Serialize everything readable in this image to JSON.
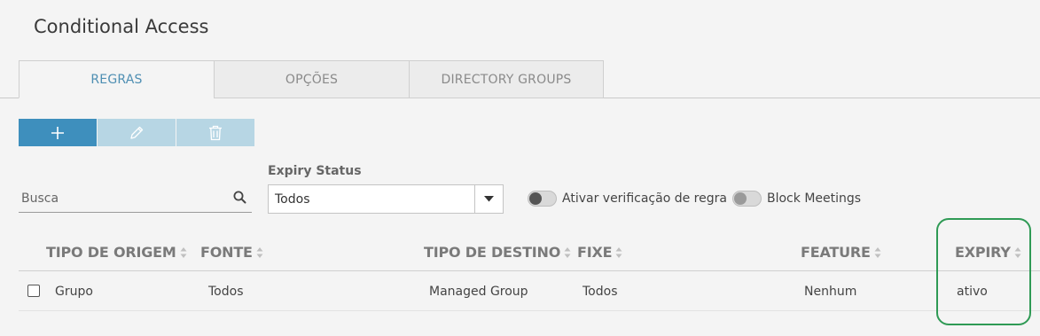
{
  "page": {
    "title": "Conditional Access"
  },
  "tabs": [
    {
      "label": "REGRAS",
      "active": true
    },
    {
      "label": "OPÇÕES",
      "active": false
    },
    {
      "label": "DIRECTORY GROUPS",
      "active": false
    }
  ],
  "toolbar": {
    "add_icon": "plus-icon",
    "edit_icon": "pencil-icon",
    "delete_icon": "trash-icon",
    "add_state": "enabled",
    "edit_state": "disabled",
    "delete_state": "disabled"
  },
  "filters": {
    "search_placeholder": "Busca",
    "search_value": "",
    "expiry_status_label": "Expiry Status",
    "expiry_status_value": "Todos",
    "toggle_rule_check_label": "Ativar verificação de regra",
    "toggle_rule_check_on": false,
    "toggle_block_meetings_label": "Block Meetings",
    "toggle_block_meetings_on": false
  },
  "table": {
    "columns": [
      "TIPO DE ORIGEM",
      "FONTE",
      "TIPO DE DESTINO",
      "FIXE",
      "FEATURE",
      "EXPIRY"
    ],
    "rows": [
      {
        "checked": false,
        "cells": [
          "Grupo",
          "Todos",
          "Managed Group",
          "Todos",
          "Nenhum",
          "ativo"
        ]
      }
    ]
  },
  "colors": {
    "accent": "#3e8fbd",
    "accent_disabled": "#b7d6e4",
    "active_tab_text": "#4f8fb3",
    "highlight": "#2f9a55"
  }
}
